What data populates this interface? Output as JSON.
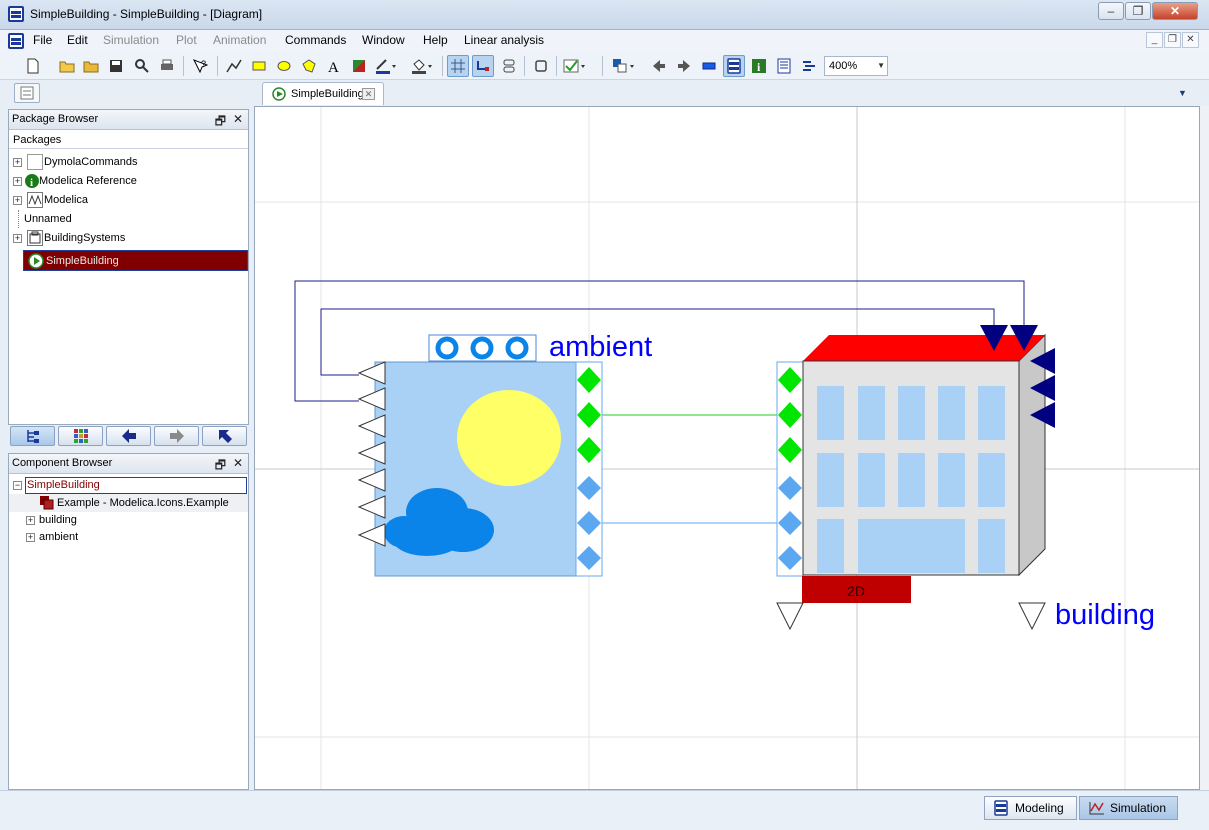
{
  "window": {
    "title": "SimpleBuilding - SimpleBuilding  - [Diagram]",
    "controls": [
      "minimize",
      "restore",
      "close"
    ]
  },
  "menubar": {
    "items": [
      {
        "label": "File",
        "enabled": true
      },
      {
        "label": "Edit",
        "enabled": true
      },
      {
        "label": "Simulation",
        "enabled": false
      },
      {
        "label": "Plot",
        "enabled": false
      },
      {
        "label": "Animation",
        "enabled": false
      },
      {
        "label": "Commands",
        "enabled": true
      },
      {
        "label": "Window",
        "enabled": true
      },
      {
        "label": "Help",
        "enabled": true
      },
      {
        "label": "Linear analysis",
        "enabled": true
      }
    ]
  },
  "toolbar": {
    "zoom": "400%",
    "icons": [
      "new-icon",
      "open-icon",
      "open-folder-icon",
      "save-icon",
      "find-icon",
      "print-icon",
      "context-help-icon",
      "line-icon",
      "rectangle-icon",
      "ellipse-icon",
      "polygon-icon",
      "text-icon",
      "bitmap-icon",
      "line-color-icon",
      "fill-color-icon",
      "grid-icon",
      "connect-mode-icon",
      "align-icon",
      "check-box-icon",
      "check-icon",
      "diagram-layer-icon",
      "back-icon",
      "forward-icon",
      "icon-layer-icon",
      "diagram-view-icon",
      "info-layer-icon",
      "documentation-icon",
      "equation-icon"
    ]
  },
  "document_tab": {
    "label": "SimpleBuilding"
  },
  "package_browser": {
    "title": "Package Browser",
    "column_header": "Packages",
    "items": [
      {
        "label": "DymolaCommands",
        "icon": "blank-package-icon"
      },
      {
        "label": "Modelica Reference",
        "icon": "info-icon"
      },
      {
        "label": "Modelica",
        "icon": "modelica-icon"
      },
      {
        "label": "Unnamed",
        "icon": ""
      },
      {
        "label": "BuildingSystems",
        "icon": "package-icon"
      },
      {
        "label": "SimpleBuilding",
        "icon": "play-icon",
        "selected": true
      }
    ]
  },
  "component_browser": {
    "title": "Component Browser",
    "items": [
      {
        "label": "SimpleBuilding"
      },
      {
        "label": "Example - Modelica.Icons.Example"
      },
      {
        "label": "building"
      },
      {
        "label": "ambient"
      }
    ]
  },
  "diagram": {
    "ambient_label": "ambient",
    "building_label": "building",
    "building_tag": "2D",
    "colors": {
      "ambient_fill": "#a9d0f5",
      "sun": "#ffff66",
      "cloud": "#0a84e8",
      "roof": "#ff0000",
      "heat_port": "#00e600",
      "signal_port": "#5ba8f0",
      "input_arrow": "#000080",
      "label": "#0000ff",
      "tag_fill": "#c00000",
      "wire_blue": "#1e1e8c",
      "wire_green": "#22cc22"
    }
  },
  "statusbar": {
    "modeling": "Modeling",
    "simulation": "Simulation"
  }
}
